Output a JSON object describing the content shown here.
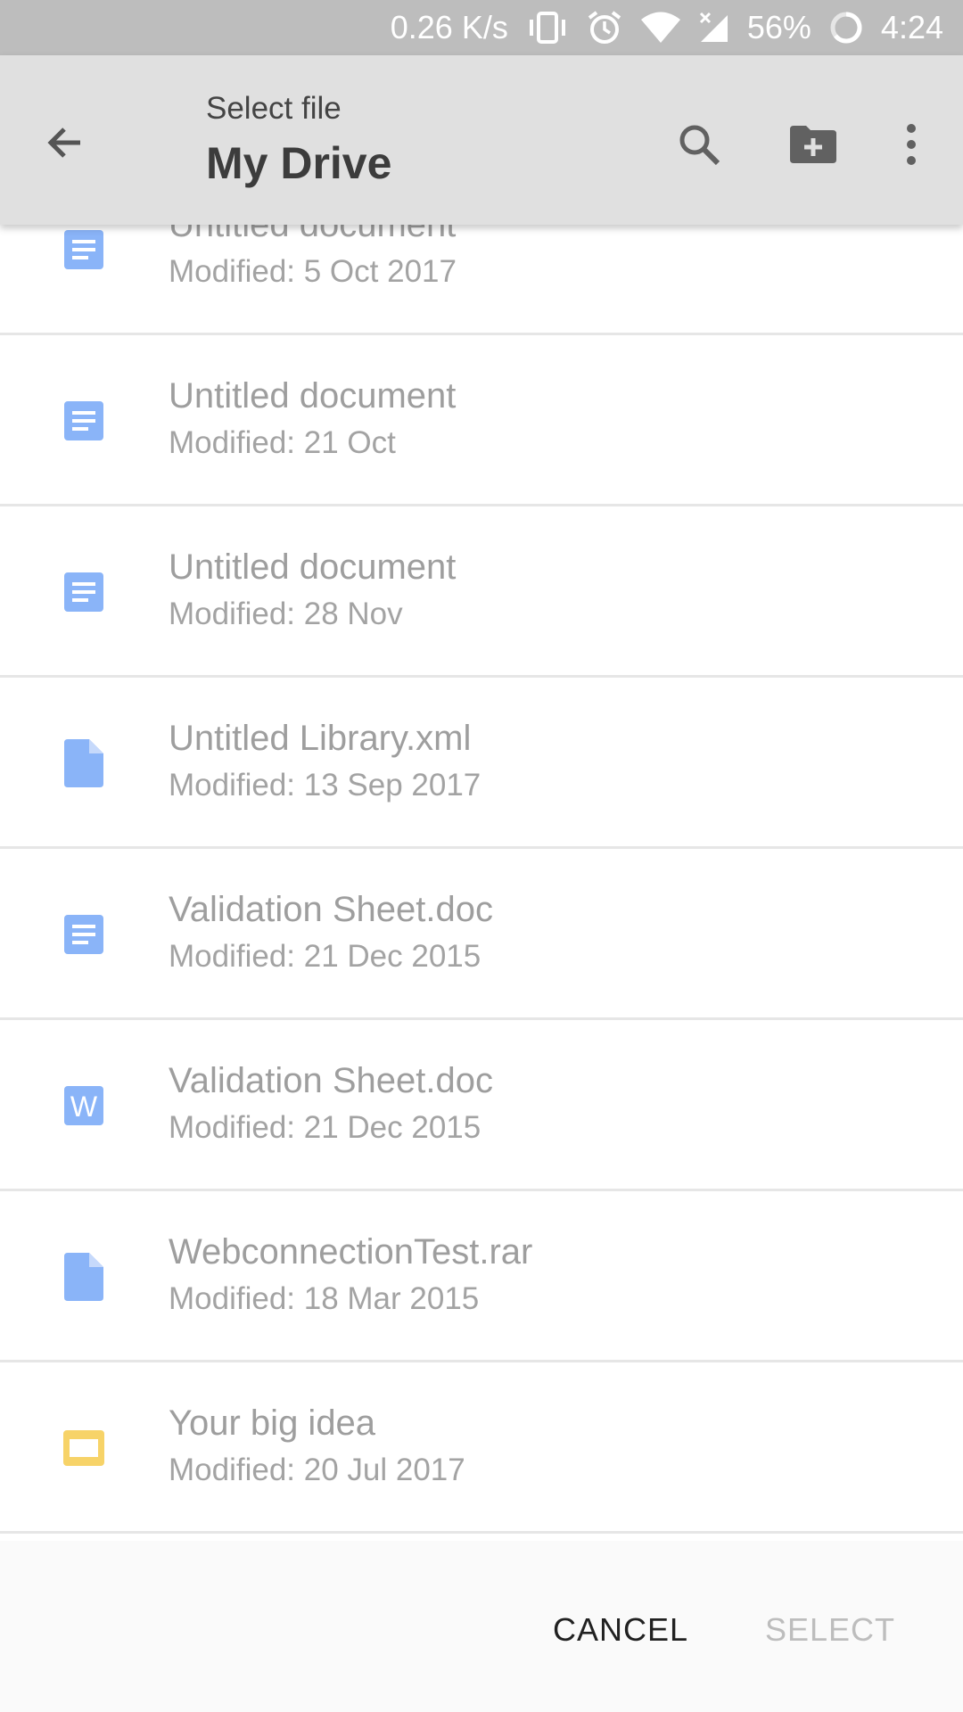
{
  "status_bar": {
    "net_speed": "0.26 K/s",
    "battery": "56%",
    "time": "4:24"
  },
  "app_bar": {
    "subtitle": "Select file",
    "title": "My Drive",
    "icons": [
      "back-arrow-icon",
      "search-icon",
      "new-folder-icon",
      "more-vert-icon"
    ]
  },
  "files": [
    {
      "name": "Untitled document",
      "modified": "Modified: 5 Oct 2017",
      "icon": "google-doc-icon",
      "color": "#8ab4f8"
    },
    {
      "name": "Untitled document",
      "modified": "Modified: 21 Oct",
      "icon": "google-doc-icon",
      "color": "#8ab4f8"
    },
    {
      "name": "Untitled document",
      "modified": "Modified: 28 Nov",
      "icon": "google-doc-icon",
      "color": "#8ab4f8"
    },
    {
      "name": "Untitled Library.xml",
      "modified": "Modified: 13 Sep 2017",
      "icon": "generic-file-icon",
      "color": "#8ab4f8"
    },
    {
      "name": "Validation Sheet.doc",
      "modified": "Modified: 21 Dec 2015",
      "icon": "google-doc-icon",
      "color": "#8ab4f8"
    },
    {
      "name": "Validation Sheet.doc",
      "modified": "Modified: 21 Dec 2015",
      "icon": "word-doc-icon",
      "icon_letter": "W",
      "color": "#8ab4f8"
    },
    {
      "name": "WebconnectionTest.rar",
      "modified": "Modified: 18 Mar 2015",
      "icon": "generic-file-icon",
      "color": "#8ab4f8"
    },
    {
      "name": "Your big idea",
      "modified": "Modified: 20 Jul 2017",
      "icon": "slides-icon",
      "color": "#f7d368"
    }
  ],
  "actions": {
    "cancel_label": "CANCEL",
    "select_label": "SELECT"
  }
}
